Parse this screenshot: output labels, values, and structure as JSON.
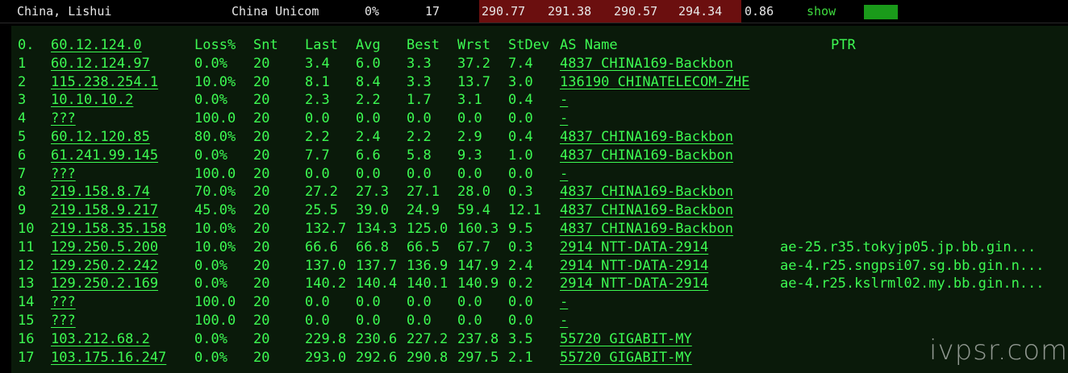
{
  "summary": {
    "location": "China, Lishui",
    "isp": "China Unicom",
    "loss": "0%",
    "hops": "17",
    "last": "290.77",
    "avg": "291.38",
    "best": "290.57",
    "worst": "294.34",
    "stdev": "0.86",
    "show_label": "show"
  },
  "headers": {
    "idx": "0.",
    "host": "60.12.124.0",
    "loss": "Loss%",
    "snt": "Snt",
    "last": "Last",
    "avg": "Avg",
    "best": "Best",
    "wrst": "Wrst",
    "stdev": "StDev",
    "as": "AS Name",
    "ptr": "PTR"
  },
  "rows": [
    {
      "idx": "1",
      "host": "60.12.124.97",
      "loss": "0.0%",
      "snt": "20",
      "last": "3.4",
      "avg": "6.0",
      "best": "3.3",
      "wrst": "37.2",
      "stdev": "7.4",
      "as": "4837  CHINA169-Backbon",
      "ptr": ""
    },
    {
      "idx": "2",
      "host": "115.238.254.1",
      "loss": "10.0%",
      "snt": "20",
      "last": "8.1",
      "avg": "8.4",
      "best": "3.3",
      "wrst": "13.7",
      "stdev": "3.0",
      "as": "136190 CHINATELECOM-ZHE",
      "ptr": ""
    },
    {
      "idx": "3",
      "host": "10.10.10.2",
      "loss": "0.0%",
      "snt": "20",
      "last": "2.3",
      "avg": "2.2",
      "best": "1.7",
      "wrst": "3.1",
      "stdev": "0.4",
      "as": "-",
      "ptr": ""
    },
    {
      "idx": "4",
      "host": "???",
      "loss": "100.0",
      "snt": "20",
      "last": "0.0",
      "avg": "0.0",
      "best": "0.0",
      "wrst": "0.0",
      "stdev": "0.0",
      "as": "-",
      "ptr": ""
    },
    {
      "idx": "5",
      "host": "60.12.120.85",
      "loss": "80.0%",
      "snt": "20",
      "last": "2.2",
      "avg": "2.4",
      "best": "2.2",
      "wrst": "2.9",
      "stdev": "0.4",
      "as": "4837  CHINA169-Backbon",
      "ptr": ""
    },
    {
      "idx": "6",
      "host": "61.241.99.145",
      "loss": "0.0%",
      "snt": "20",
      "last": "7.7",
      "avg": "6.6",
      "best": "5.8",
      "wrst": "9.3",
      "stdev": "1.0",
      "as": "4837  CHINA169-Backbon",
      "ptr": ""
    },
    {
      "idx": "7",
      "host": "???",
      "loss": "100.0",
      "snt": "20",
      "last": "0.0",
      "avg": "0.0",
      "best": "0.0",
      "wrst": "0.0",
      "stdev": "0.0",
      "as": "-",
      "ptr": ""
    },
    {
      "idx": "8",
      "host": "219.158.8.74",
      "loss": "70.0%",
      "snt": "20",
      "last": "27.2",
      "avg": "27.3",
      "best": "27.1",
      "wrst": "28.0",
      "stdev": "0.3",
      "as": "4837  CHINA169-Backbon",
      "ptr": ""
    },
    {
      "idx": "9",
      "host": "219.158.9.217",
      "loss": "45.0%",
      "snt": "20",
      "last": "25.5",
      "avg": "39.0",
      "best": "24.9",
      "wrst": "59.4",
      "stdev": "12.1",
      "as": "4837  CHINA169-Backbon",
      "ptr": ""
    },
    {
      "idx": "10",
      "host": "219.158.35.158",
      "loss": "10.0%",
      "snt": "20",
      "last": "132.7",
      "avg": "134.3",
      "best": "125.0",
      "wrst": "160.3",
      "stdev": "9.5",
      "as": "4837  CHINA169-Backbon",
      "ptr": ""
    },
    {
      "idx": "11",
      "host": "129.250.5.200",
      "loss": "10.0%",
      "snt": "20",
      "last": "66.6",
      "avg": "66.8",
      "best": "66.5",
      "wrst": "67.7",
      "stdev": "0.3",
      "as": "2914  NTT-DATA-2914",
      "ptr": "ae-25.r35.tokyjp05.jp.bb.gin..."
    },
    {
      "idx": "12",
      "host": "129.250.2.242",
      "loss": "0.0%",
      "snt": "20",
      "last": "137.0",
      "avg": "137.7",
      "best": "136.9",
      "wrst": "147.9",
      "stdev": "2.4",
      "as": "2914  NTT-DATA-2914",
      "ptr": "ae-4.r25.sngpsi07.sg.bb.gin.n..."
    },
    {
      "idx": "13",
      "host": "129.250.2.169",
      "loss": "0.0%",
      "snt": "20",
      "last": "140.2",
      "avg": "140.4",
      "best": "140.1",
      "wrst": "140.9",
      "stdev": "0.2",
      "as": "2914  NTT-DATA-2914",
      "ptr": "ae-4.r25.kslrml02.my.bb.gin.n..."
    },
    {
      "idx": "14",
      "host": "???",
      "loss": "100.0",
      "snt": "20",
      "last": "0.0",
      "avg": "0.0",
      "best": "0.0",
      "wrst": "0.0",
      "stdev": "0.0",
      "as": "-",
      "ptr": ""
    },
    {
      "idx": "15",
      "host": "???",
      "loss": "100.0",
      "snt": "20",
      "last": "0.0",
      "avg": "0.0",
      "best": "0.0",
      "wrst": "0.0",
      "stdev": "0.0",
      "as": "-",
      "ptr": ""
    },
    {
      "idx": "16",
      "host": "103.212.68.2",
      "loss": "0.0%",
      "snt": "20",
      "last": "229.8",
      "avg": "230.6",
      "best": "227.2",
      "wrst": "237.8",
      "stdev": "3.5",
      "as": "55720 GIGABIT-MY",
      "ptr": ""
    },
    {
      "idx": "17",
      "host": "103.175.16.247",
      "loss": "0.0%",
      "snt": "20",
      "last": "293.0",
      "avg": "292.6",
      "best": "290.8",
      "wrst": "297.5",
      "stdev": "2.1",
      "as": "55720 GIGABIT-MY",
      "ptr": ""
    }
  ],
  "watermark": "ivpsr.com",
  "colors": {
    "text_green": "#3dfa52",
    "panel_bg": "#0a1a0a",
    "latency_bg": "#6b0f0f",
    "show_bar": "#1a9a1a"
  }
}
